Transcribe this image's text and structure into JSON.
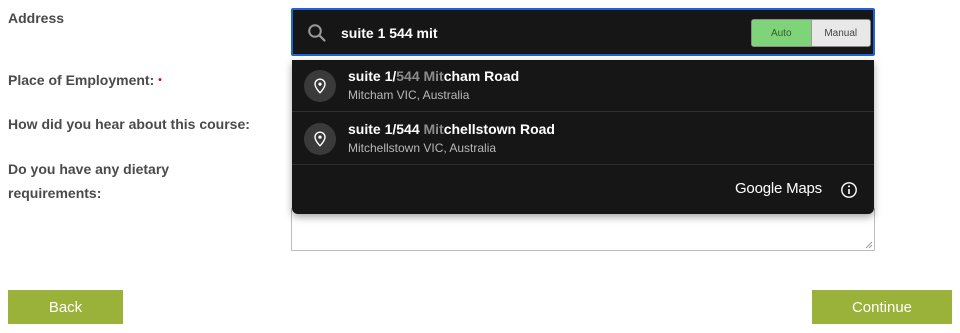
{
  "form": {
    "address_label": "Address",
    "employment_label": "Place of Employment:",
    "required_marker": "•",
    "hear_label": "How did you hear about this course:",
    "dietary_label_line1": "Do you have any dietary",
    "dietary_label_line2": "requirements:"
  },
  "search": {
    "value": "suite 1 544 mit",
    "icon": "search-icon",
    "mode_options": [
      "Auto",
      "Manual"
    ],
    "selected_mode": "Auto"
  },
  "suggestions": [
    {
      "main_prefix": "suite 1/",
      "main_dim": "544 Mit",
      "main_rest": "cham Road",
      "sub": "Mitcham VIC, Australia",
      "icon": "location-pin-icon"
    },
    {
      "main_prefix": "suite 1/544 ",
      "main_dim": "Mit",
      "main_rest": "chellstown Road",
      "sub": "Mitchellstown VIC, Australia",
      "icon": "location-pin-icon"
    }
  ],
  "attribution": {
    "text": "Google Maps",
    "info_icon": "info-icon"
  },
  "buttons": {
    "back": "Back",
    "continue": "Continue"
  },
  "colors": {
    "accent_green": "#9bb23a",
    "focus_blue": "#1e64d6",
    "dropdown_bg": "#161616",
    "toggle_active": "#7fd47a"
  }
}
